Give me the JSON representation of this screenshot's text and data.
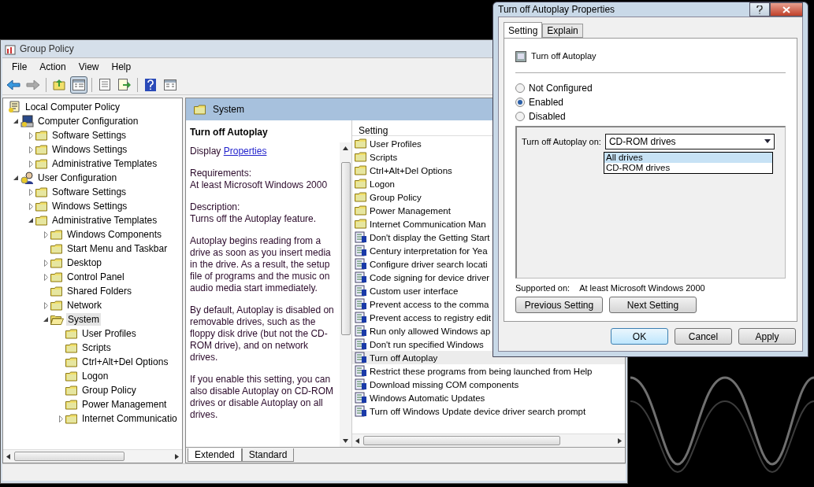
{
  "main_window": {
    "title": "Group Policy",
    "menu": [
      "File",
      "Action",
      "View",
      "Help"
    ],
    "toolbar": [
      {
        "kind": "back",
        "pressed": false
      },
      {
        "kind": "forward",
        "pressed": false
      },
      {
        "kind": "separator"
      },
      {
        "kind": "up",
        "pressed": false
      },
      {
        "kind": "tree",
        "pressed": true
      },
      {
        "kind": "separator"
      },
      {
        "kind": "properties",
        "pressed": false
      },
      {
        "kind": "export",
        "pressed": false
      },
      {
        "kind": "separator"
      },
      {
        "kind": "help",
        "pressed": false
      },
      {
        "kind": "view",
        "pressed": false
      }
    ],
    "tree": [
      {
        "label": "Local Computer Policy",
        "kind": "policy",
        "selected": false,
        "children": [
          {
            "label": "Computer Configuration",
            "kind": "computer",
            "expanded": true,
            "selected": false,
            "children": [
              {
                "label": "Software Settings",
                "kind": "folder",
                "expanded": false,
                "selected": false
              },
              {
                "label": "Windows Settings",
                "kind": "folder",
                "expanded": false,
                "selected": false
              },
              {
                "label": "Administrative Templates",
                "kind": "folder",
                "expanded": false,
                "selected": false
              }
            ]
          },
          {
            "label": "User Configuration",
            "kind": "user",
            "expanded": true,
            "selected": false,
            "children": [
              {
                "label": "Software Settings",
                "kind": "folder",
                "expanded": false,
                "selected": false
              },
              {
                "label": "Windows Settings",
                "kind": "folder",
                "expanded": false,
                "selected": false
              },
              {
                "label": "Administrative Templates",
                "kind": "folder",
                "expanded": true,
                "selected": false,
                "children": [
                  {
                    "label": "Windows Components",
                    "kind": "folder",
                    "expanded": false,
                    "selected": false
                  },
                  {
                    "label": "Start Menu and Taskbar",
                    "kind": "folder",
                    "selected": false
                  },
                  {
                    "label": "Desktop",
                    "kind": "folder",
                    "expanded": false,
                    "selected": false
                  },
                  {
                    "label": "Control Panel",
                    "kind": "folder",
                    "expanded": false,
                    "selected": false
                  },
                  {
                    "label": "Shared Folders",
                    "kind": "folder",
                    "selected": false
                  },
                  {
                    "label": "Network",
                    "kind": "folder",
                    "expanded": false,
                    "selected": false
                  },
                  {
                    "label": "System",
                    "kind": "open-folder",
                    "expanded": true,
                    "selected": true,
                    "children": [
                      {
                        "label": "User Profiles",
                        "kind": "folder",
                        "selected": false
                      },
                      {
                        "label": "Scripts",
                        "kind": "folder",
                        "selected": false
                      },
                      {
                        "label": "Ctrl+Alt+Del Options",
                        "kind": "folder",
                        "selected": false
                      },
                      {
                        "label": "Logon",
                        "kind": "folder",
                        "selected": false
                      },
                      {
                        "label": "Group Policy",
                        "kind": "folder",
                        "selected": false
                      },
                      {
                        "label": "Power Management",
                        "kind": "folder",
                        "selected": false
                      },
                      {
                        "label": "Internet Communicatio",
                        "kind": "folder",
                        "expanded": false,
                        "selected": false
                      }
                    ]
                  }
                ]
              }
            ]
          }
        ]
      }
    ],
    "header": {
      "title": "System"
    },
    "description": {
      "title": "Turn off Autoplay",
      "display_prefix": "Display",
      "link": "Properties",
      "paragraphs": [
        "Requirements:\nAt least Microsoft Windows 2000",
        "Description:\nTurns off the Autoplay feature.",
        "Autoplay begins reading from a drive as soon as you insert media in the drive. As a result, the setup file of programs and the music on audio media start immediately.",
        "By default, Autoplay is disabled on removable drives, such as the floppy disk drive (but not the CD-ROM drive), and on network drives.",
        "If you enable this setting, you can also disable Autoplay on CD-ROM drives or disable Autoplay on all drives."
      ]
    },
    "list": {
      "column": "Setting",
      "items": [
        {
          "label": "User Profiles",
          "kind": "folder",
          "selected": false
        },
        {
          "label": "Scripts",
          "kind": "folder",
          "selected": false
        },
        {
          "label": "Ctrl+Alt+Del Options",
          "kind": "folder",
          "selected": false
        },
        {
          "label": "Logon",
          "kind": "folder",
          "selected": false
        },
        {
          "label": "Group Policy",
          "kind": "folder",
          "selected": false
        },
        {
          "label": "Power Management",
          "kind": "folder",
          "selected": false
        },
        {
          "label": "Internet Communication Man",
          "kind": "folder",
          "selected": false
        },
        {
          "label": "Don't display the Getting Start",
          "kind": "setting",
          "selected": false
        },
        {
          "label": "Century interpretation for Yea",
          "kind": "setting",
          "selected": false
        },
        {
          "label": "Configure driver search locati",
          "kind": "setting",
          "selected": false
        },
        {
          "label": "Code signing for device driver",
          "kind": "setting",
          "selected": false
        },
        {
          "label": "Custom user interface",
          "kind": "setting",
          "selected": false
        },
        {
          "label": "Prevent access to the comma",
          "kind": "setting",
          "selected": false
        },
        {
          "label": "Prevent access to registry edit",
          "kind": "setting",
          "selected": false
        },
        {
          "label": "Run only allowed Windows ap",
          "kind": "setting",
          "selected": false
        },
        {
          "label": "Don't run specified Windows",
          "kind": "setting",
          "selected": false
        },
        {
          "label": "Turn off Autoplay",
          "kind": "setting",
          "selected": true
        },
        {
          "label": "Restrict these programs from being launched from Help",
          "kind": "setting",
          "selected": false
        },
        {
          "label": "Download missing COM components",
          "kind": "setting",
          "selected": false
        },
        {
          "label": "Windows Automatic Updates",
          "kind": "setting",
          "selected": false
        },
        {
          "label": "Turn off Windows Update device driver search prompt",
          "kind": "setting",
          "selected": false
        }
      ]
    },
    "view_tabs": [
      {
        "label": "Extended",
        "selected": true
      },
      {
        "label": "Standard",
        "selected": false
      }
    ]
  },
  "dialog": {
    "title": "Turn off Autoplay Properties",
    "tabs": [
      {
        "label": "Setting",
        "selected": true
      },
      {
        "label": "Explain",
        "selected": false
      }
    ],
    "policy_name": "Turn off Autoplay",
    "options": [
      {
        "label": "Not Configured",
        "selected": false
      },
      {
        "label": "Enabled",
        "selected": true
      },
      {
        "label": "Disabled",
        "selected": false
      }
    ],
    "dropdown": {
      "label": "Turn off Autoplay on:",
      "value": "CD-ROM drives",
      "expanded": true,
      "options": [
        {
          "label": "All drives",
          "highlighted": true
        },
        {
          "label": "CD-ROM drives",
          "highlighted": false
        }
      ]
    },
    "supported_label": "Supported on:",
    "supported_value": "At least Microsoft Windows 2000",
    "nav_buttons": [
      "Previous Setting",
      "Next Setting"
    ],
    "buttons": [
      {
        "label": "OK",
        "default": true
      },
      {
        "label": "Cancel",
        "default": false
      },
      {
        "label": "Apply",
        "default": false
      }
    ]
  }
}
